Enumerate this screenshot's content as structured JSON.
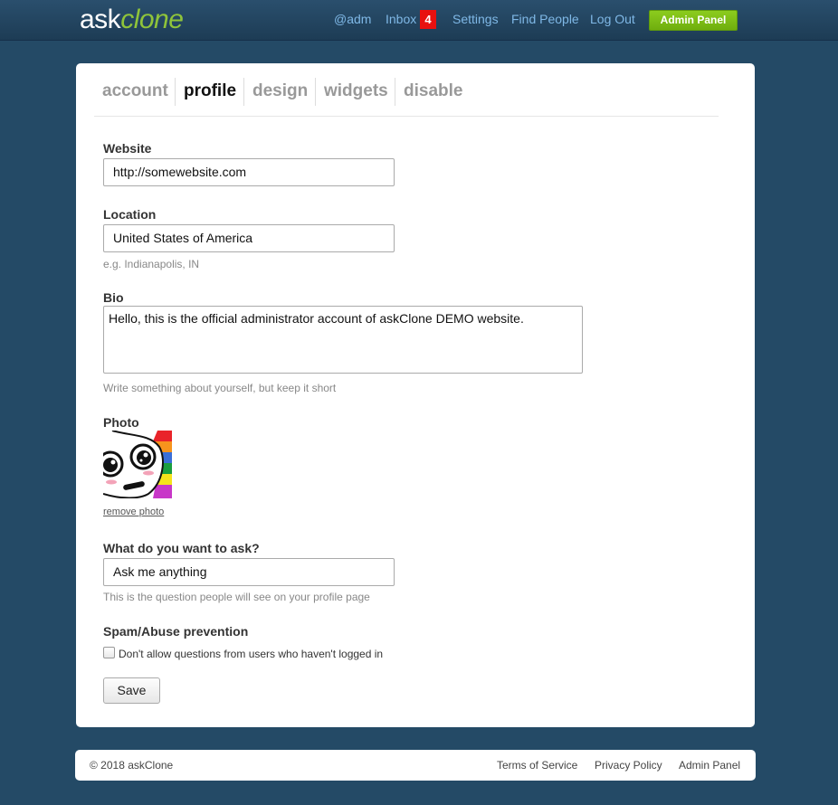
{
  "brand": {
    "ask": "ask",
    "clone": "clone"
  },
  "nav": {
    "user": "@adm",
    "inbox": "Inbox",
    "inbox_count": "4",
    "settings": "Settings",
    "find_people": "Find People",
    "logout": "Log Out",
    "admin_panel": "Admin Panel"
  },
  "tabs": [
    {
      "label": "account",
      "active": false
    },
    {
      "label": "profile",
      "active": true
    },
    {
      "label": "design",
      "active": false
    },
    {
      "label": "widgets",
      "active": false
    },
    {
      "label": "disable",
      "active": false
    }
  ],
  "form": {
    "website": {
      "label": "Website",
      "value": "http://somewebsite.com"
    },
    "location": {
      "label": "Location",
      "value": "United States of America",
      "help": "e.g. Indianapolis, IN"
    },
    "bio": {
      "label": "Bio",
      "value": "Hello, this is the official administrator account of askClone DEMO website.",
      "help": "Write something about yourself, but keep it short"
    },
    "photo": {
      "label": "Photo",
      "remove_link": "remove photo"
    },
    "ask": {
      "label": "What do you want to ask?",
      "value": "Ask me anything",
      "help": "This is the question people will see on your profile page"
    },
    "spam": {
      "label": "Spam/Abuse prevention",
      "checkbox_label": "Don't allow questions from users who haven't logged in",
      "checked": false
    },
    "save": "Save"
  },
  "footer": {
    "copyright": "© 2018 askClone",
    "terms": "Terms of Service",
    "privacy": "Privacy Policy",
    "admin": "Admin Panel"
  },
  "colors": {
    "background": "#244a66",
    "nav_link": "#7fb8e6",
    "accent_green": "#8fc43a",
    "badge_red": "#e8110f"
  }
}
